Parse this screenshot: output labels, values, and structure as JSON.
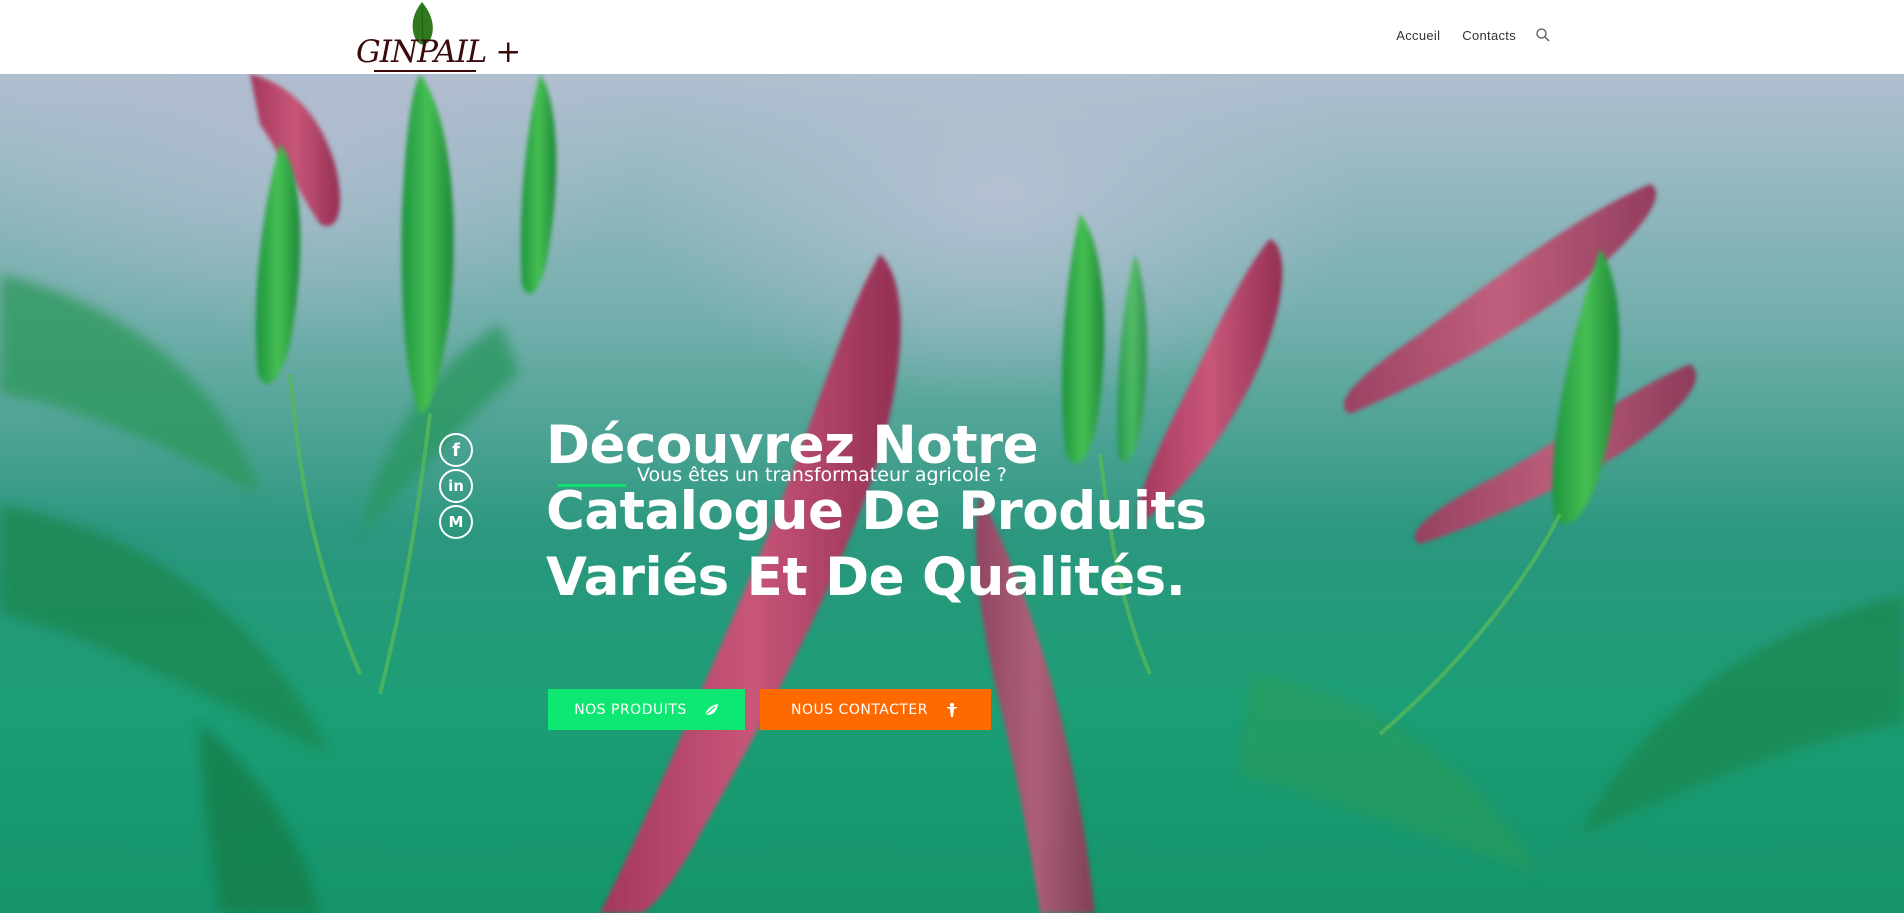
{
  "header": {
    "logo_text": "GINPAIL +",
    "nav": {
      "home_label": "Accueil",
      "contacts_label": "Contacts",
      "search_icon": "search-icon"
    }
  },
  "hero": {
    "tagline": "Vous êtes un transformateur agricole ?",
    "headline_line1": "Découvrez Notre",
    "headline_line2": "Catalogue De Produits",
    "headline_line3": "Variés Et De Qualités.",
    "social": {
      "facebook_glyph": "f",
      "linkedin_glyph": "in",
      "medium_glyph": "M"
    },
    "buttons": {
      "products_label": "NOS PRODUITS",
      "products_icon": "leaf-icon",
      "contact_label": "NOUS CONTACTER",
      "contact_icon": "person-icon"
    }
  },
  "colors": {
    "accent_green": "#0ee771",
    "accent_orange": "#ff6a00",
    "logo_color": "#3b0a0a"
  }
}
